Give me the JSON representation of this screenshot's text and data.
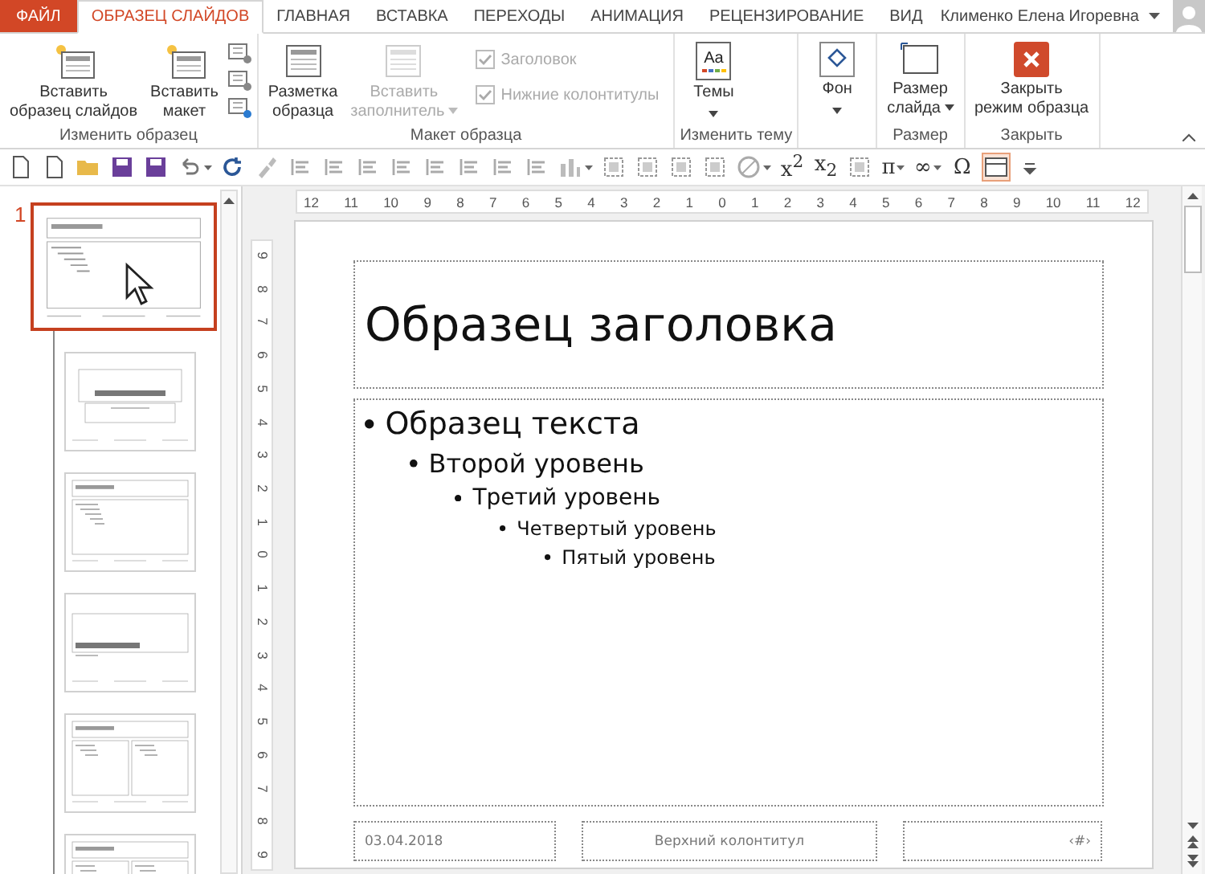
{
  "tabs": [
    {
      "label": "ФАЙЛ",
      "kind": "file",
      "selected": false
    },
    {
      "label": "ОБРАЗЕЦ СЛАЙДОВ",
      "kind": "tab",
      "selected": true
    },
    {
      "label": "ГЛАВНАЯ",
      "kind": "tab",
      "selected": false
    },
    {
      "label": "ВСТАВКА",
      "kind": "tab",
      "selected": false
    },
    {
      "label": "ПЕРЕХОДЫ",
      "kind": "tab",
      "selected": false
    },
    {
      "label": "АНИМАЦИЯ",
      "kind": "tab",
      "selected": false
    },
    {
      "label": "РЕЦЕНЗИРОВАНИЕ",
      "kind": "tab",
      "selected": false
    },
    {
      "label": "ВИД",
      "kind": "tab",
      "selected": false
    }
  ],
  "user": {
    "name": "Клименко Елена Игоревна"
  },
  "ribbon_groups": [
    {
      "label": "Изменить образец",
      "items": [
        {
          "kind": "big",
          "label": "Вставить\nобразец слайдов",
          "disabled": false,
          "caret": false
        },
        {
          "kind": "big",
          "label": "Вставить\nмакет",
          "disabled": false,
          "caret": false
        },
        {
          "kind": "smallstack"
        }
      ]
    },
    {
      "label": "Макет образца",
      "items": [
        {
          "kind": "big",
          "label": "Разметка\nобразца",
          "disabled": false,
          "caret": false
        },
        {
          "kind": "big",
          "label": "Вставить\nзаполнитель",
          "disabled": true,
          "caret": true
        },
        {
          "kind": "checks",
          "checks": [
            {
              "label": "Заголовок",
              "checked": true,
              "disabled": true
            },
            {
              "label": "Нижние колонтитулы",
              "checked": true,
              "disabled": true
            }
          ]
        }
      ]
    },
    {
      "label": "Изменить тему",
      "items": [
        {
          "kind": "big",
          "icon_text": "Aa",
          "label": "Темы",
          "disabled": false,
          "caret": true
        }
      ]
    },
    {
      "items": [
        {
          "kind": "big",
          "label": "Фон",
          "disabled": false,
          "caret": true
        }
      ]
    },
    {
      "label": "Размер",
      "items": [
        {
          "kind": "big",
          "label": "Размер\nслайда",
          "disabled": false,
          "caret": true
        }
      ]
    },
    {
      "label": "Закрыть",
      "items": [
        {
          "kind": "big",
          "label": "Закрыть\nрежим образца",
          "disabled": false,
          "caret": false
        }
      ]
    }
  ],
  "toolbar": [
    {
      "kind": "page",
      "caret": false,
      "selected": false
    },
    {
      "kind": "page",
      "caret": false,
      "selected": false
    },
    {
      "kind": "folder",
      "caret": false,
      "selected": false
    },
    {
      "kind": "save",
      "caret": false,
      "selected": false
    },
    {
      "kind": "save",
      "caret": false,
      "selected": false
    },
    {
      "kind": "undo",
      "caret": true,
      "selected": false
    },
    {
      "kind": "redo",
      "caret": false,
      "selected": false
    },
    {
      "kind": "brush",
      "caret": false,
      "selected": false
    },
    {
      "kind": "lines",
      "caret": false,
      "selected": false
    },
    {
      "kind": "lines",
      "caret": false,
      "selected": false
    },
    {
      "kind": "lines",
      "caret": false,
      "selected": false
    },
    {
      "kind": "lines",
      "caret": false,
      "selected": false
    },
    {
      "kind": "lines",
      "caret": false,
      "selected": false
    },
    {
      "kind": "lines",
      "caret": false,
      "selected": false
    },
    {
      "kind": "lines",
      "caret": false,
      "selected": false
    },
    {
      "kind": "lines",
      "caret": false,
      "selected": false
    },
    {
      "kind": "chart",
      "caret": true,
      "selected": false
    },
    {
      "kind": "frame",
      "caret": false,
      "selected": false
    },
    {
      "kind": "frame",
      "caret": false,
      "selected": false
    },
    {
      "kind": "frame",
      "caret": false,
      "selected": false
    },
    {
      "kind": "frame",
      "caret": false,
      "selected": false
    },
    {
      "kind": "circle",
      "caret": true,
      "selected": false
    },
    {
      "kind": "glyph",
      "glyph": "x$^{2}$",
      "caret": false,
      "selected": false
    },
    {
      "kind": "glyph",
      "glyph": "x$_{2}$",
      "caret": false,
      "selected": false
    },
    {
      "kind": "frame",
      "caret": false,
      "selected": false
    },
    {
      "kind": "glyph",
      "glyph": "π",
      "caret": true,
      "selected": false
    },
    {
      "kind": "glyph",
      "glyph": "∞",
      "caret": true,
      "selected": false
    },
    {
      "kind": "glyph",
      "glyph": "Ω",
      "caret": false,
      "selected": false
    },
    {
      "kind": "grid",
      "caret": false,
      "selected": true
    },
    {
      "kind": "more",
      "caret": false,
      "selected": false
    }
  ],
  "slide_number": "1",
  "thumbnails": [
    {
      "kind": "content",
      "selected": true
    },
    {
      "kind": "title",
      "selected": false
    },
    {
      "kind": "content",
      "selected": false
    },
    {
      "kind": "section",
      "selected": false
    },
    {
      "kind": "two",
      "selected": false
    },
    {
      "kind": "two",
      "selected": false
    }
  ],
  "ruler": {
    "h_labels": [
      "12",
      "11",
      "10",
      "9",
      "8",
      "7",
      "6",
      "5",
      "4",
      "3",
      "2",
      "1",
      "0",
      "1",
      "2",
      "3",
      "4",
      "5",
      "6",
      "7",
      "8",
      "9",
      "10",
      "11",
      "12"
    ],
    "v_labels": [
      "9",
      "8",
      "7",
      "6",
      "5",
      "4",
      "3",
      "2",
      "1",
      "0",
      "1",
      "2",
      "3",
      "4",
      "5",
      "6",
      "7",
      "8",
      "9"
    ]
  },
  "slide": {
    "title": "Образец заголовка",
    "bullets": [
      {
        "text": "Образец текста",
        "children": [
          {
            "text": "Второй уровень",
            "children": [
              {
                "text": "Третий уровень",
                "children": [
                  {
                    "text": "Четвертый уровень",
                    "children": [
                      {
                        "text": "Пятый уровень"
                      }
                    ]
                  }
                ]
              }
            ]
          }
        ]
      }
    ],
    "footer": {
      "date": "03.04.2018",
      "center": "Верхний колонтитул",
      "number": "‹#›"
    }
  }
}
